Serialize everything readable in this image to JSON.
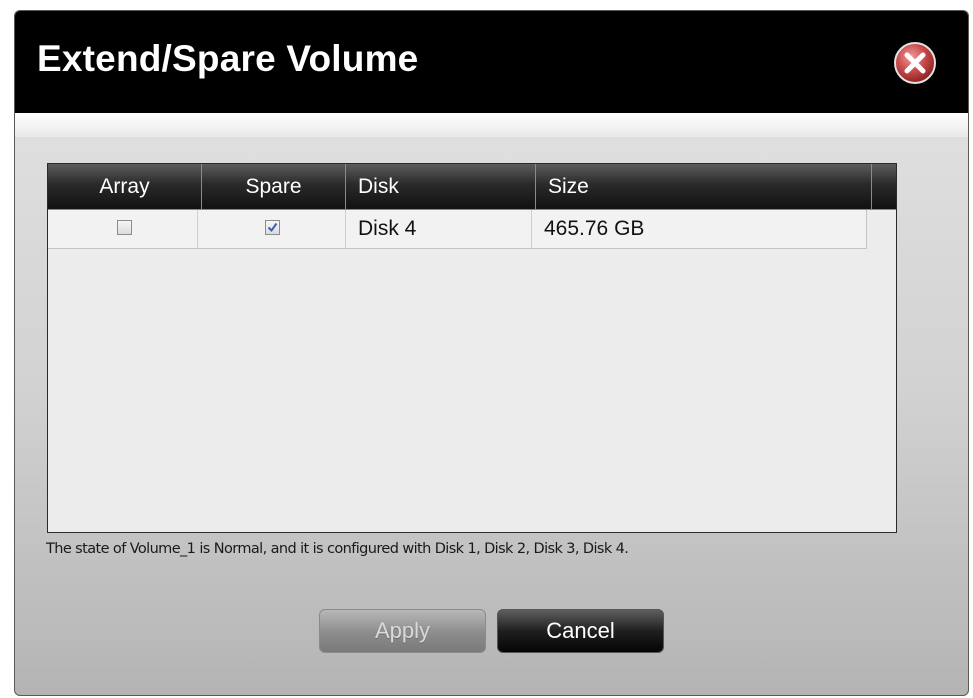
{
  "dialog": {
    "title": "Extend/Spare Volume",
    "close_icon": "close-x-icon"
  },
  "table": {
    "columns": [
      "Array",
      "Spare",
      "Disk",
      "Size"
    ],
    "rows": [
      {
        "array_checked": false,
        "spare_checked": true,
        "disk": "Disk 4",
        "size": "465.76 GB"
      }
    ]
  },
  "status": {
    "message": "The state of Volume_1 is Normal, and it is configured with Disk 1, Disk 2, Disk 3, Disk 4."
  },
  "buttons": {
    "apply_label": "Apply",
    "apply_enabled": false,
    "cancel_label": "Cancel"
  },
  "colors": {
    "titlebar": "#000000",
    "close_button": "#c44b4b",
    "check_mark": "#3a5fb0"
  }
}
